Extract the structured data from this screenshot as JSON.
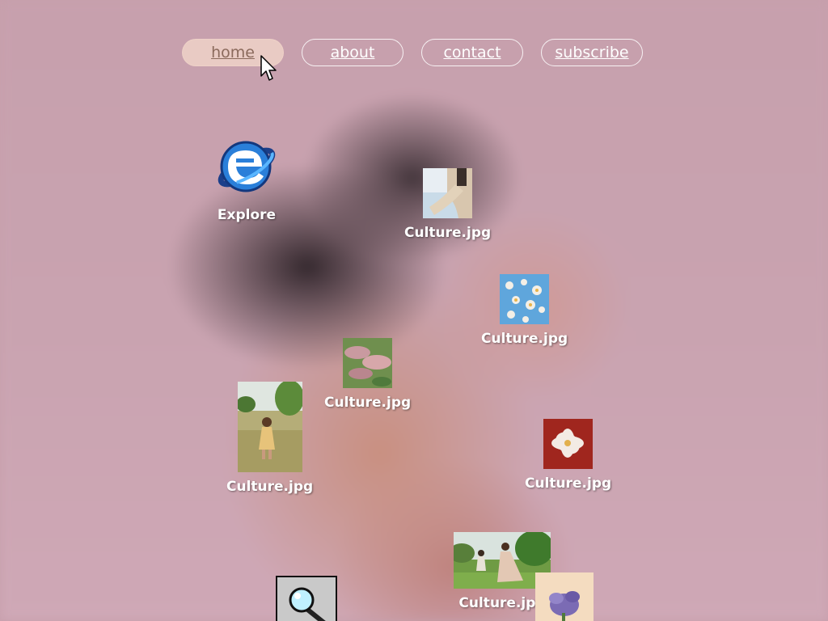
{
  "nav": {
    "items": [
      {
        "label": "home",
        "active": true
      },
      {
        "label": "about",
        "active": false
      },
      {
        "label": "contact",
        "active": false
      },
      {
        "label": "subscribe",
        "active": false
      }
    ]
  },
  "desktop": {
    "explore": {
      "label": "Explore",
      "icon": "internet-explorer-icon"
    },
    "files": [
      {
        "label": "Culture.jpg"
      },
      {
        "label": "Culture.jpg"
      },
      {
        "label": "Culture.jpg"
      },
      {
        "label": "Culture.jpg"
      },
      {
        "label": "Culture.jpg"
      },
      {
        "label": "Culture.jpg"
      }
    ],
    "search_icon": "magnifier-icon"
  },
  "colors": {
    "background": "#c9a3b0",
    "nav_active": "#eed2c8",
    "label": "#ffffff"
  }
}
